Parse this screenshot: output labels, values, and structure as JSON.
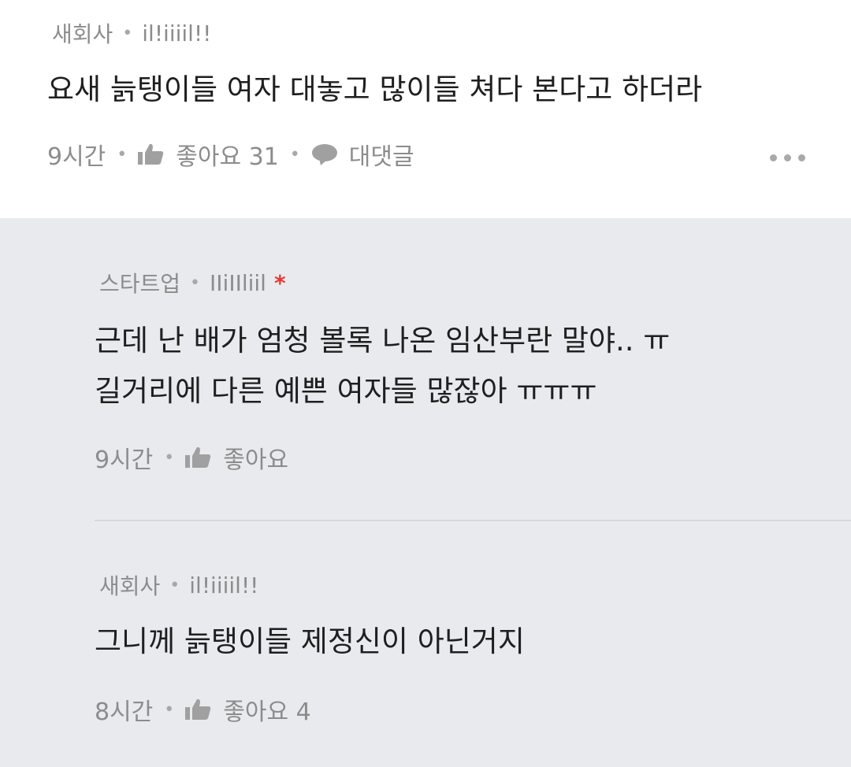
{
  "comment": {
    "company": "새회사",
    "username": "il!iiiil!!",
    "text": "요새 늙탱이들 여자 대놓고 많이들 쳐다 본다고 하더라",
    "time": "9시간",
    "like_label": "좋아요 31",
    "reply_label": "대댓글",
    "icons": {
      "like": "thumbs-up-icon",
      "reply": "speech-bubble-icon",
      "more": "more-options-icon"
    }
  },
  "replies": [
    {
      "company": "스타트업",
      "username": "IIiIIliil",
      "author_mark": "*",
      "text_lines": [
        "근데 난 배가 엄청 볼록 나온 임산부란 말야.. ㅠ",
        "길거리에 다른 예쁜 여자들 많잖아 ㅠㅠㅠ"
      ],
      "time": "9시간",
      "like_label": "좋아요"
    },
    {
      "company": "새회사",
      "username": "il!iiiil!!",
      "text_lines": [
        "그니께 늙탱이들 제정신이 아닌거지"
      ],
      "time": "8시간",
      "like_label": "좋아요 4"
    }
  ],
  "colors": {
    "reply_background": "#e9eaed",
    "meta_text": "#8c8c8c",
    "author_mark": "#e53935"
  }
}
